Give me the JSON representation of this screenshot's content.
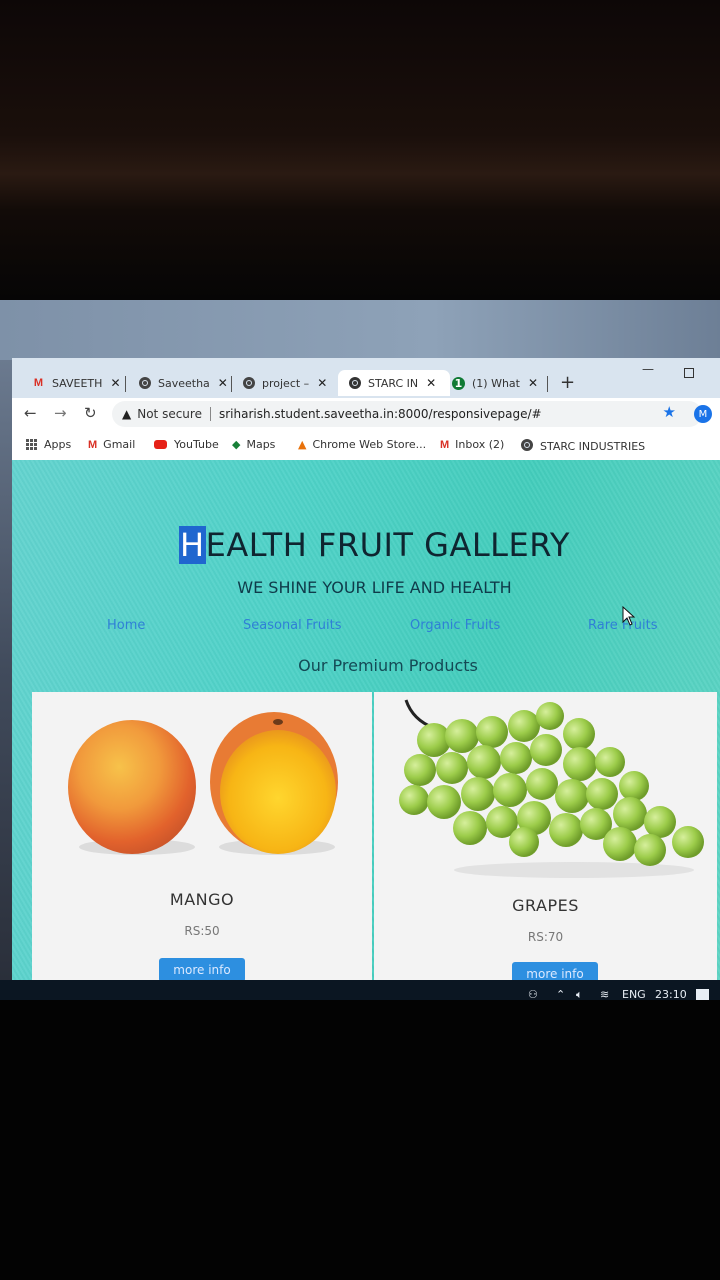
{
  "browser": {
    "tabs": [
      {
        "label": "SAVEETH",
        "icon": "gmail-icon"
      },
      {
        "label": "Saveetha",
        "icon": "globe-icon"
      },
      {
        "label": "project –",
        "icon": "globe-icon"
      },
      {
        "label": "STARC IN",
        "icon": "globe-icon",
        "active": true
      },
      {
        "label": "(1) What",
        "icon": "whatsapp-icon"
      }
    ],
    "new_tab": "+",
    "address": {
      "security_label": "Not secure",
      "url": "sriharish.student.saveetha.in:8000/responsivepage/#"
    },
    "profile_initial": "M",
    "bookmarks": [
      {
        "label": "Apps"
      },
      {
        "label": "Gmail"
      },
      {
        "label": "YouTube"
      },
      {
        "label": "Maps"
      },
      {
        "label": "Chrome Web Store..."
      },
      {
        "label": "Inbox (2)"
      },
      {
        "label": "STARC INDUSTRIES"
      }
    ]
  },
  "site": {
    "title_first": "H",
    "title_rest": "EALTH FRUIT GALLERY",
    "tagline": "WE SHINE YOUR LIFE AND HEALTH",
    "nav": [
      "Home",
      "Seasonal Fruits",
      "Organic Fruits",
      "Rare Fruits"
    ],
    "products_heading": "Our Premium Products",
    "products": [
      {
        "name": "MANGO",
        "price": "RS:50",
        "button": "more info"
      },
      {
        "name": "GRAPES",
        "price": "RS:70",
        "button": "more info"
      }
    ]
  },
  "taskbar": {
    "language": "ENG",
    "time": "23:10"
  },
  "colors": {
    "page_accent": "#4fd2c8",
    "link": "#2f7fd6",
    "button": "#2d8fe0",
    "title_highlight": "#1f66cf"
  }
}
